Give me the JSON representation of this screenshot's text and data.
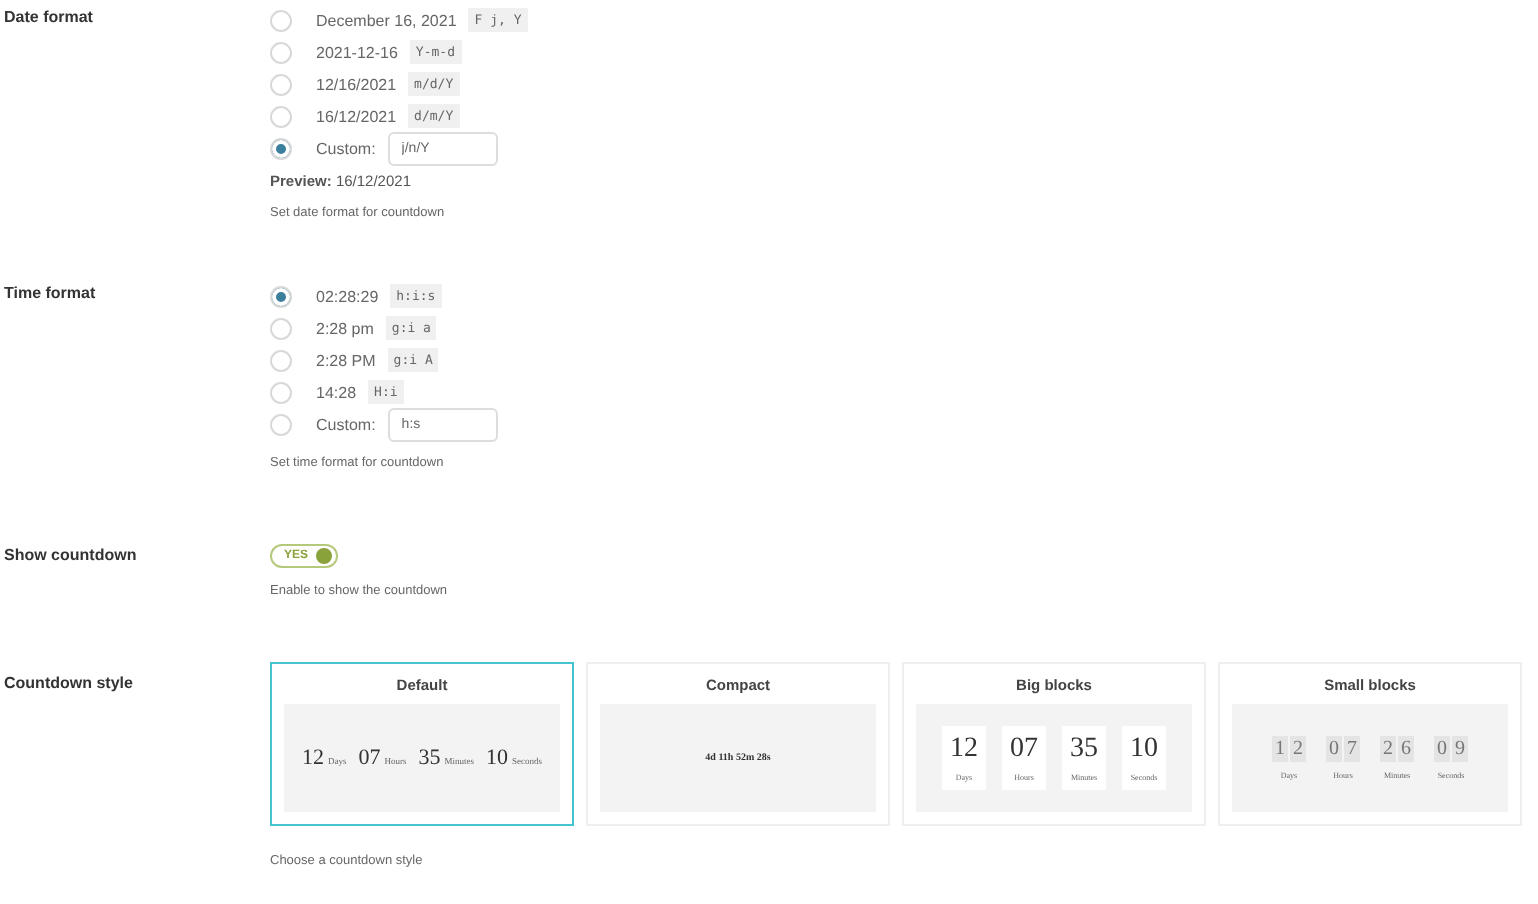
{
  "date_format": {
    "label": "Date format",
    "options": [
      {
        "kind": "preset",
        "text": "December 16, 2021",
        "code": "F j, Y",
        "selected": false
      },
      {
        "kind": "preset",
        "text": "2021-12-16",
        "code": "Y-m-d",
        "selected": false
      },
      {
        "kind": "preset",
        "text": "12/16/2021",
        "code": "m/d/Y",
        "selected": false
      },
      {
        "kind": "preset",
        "text": "16/12/2021",
        "code": "d/m/Y",
        "selected": false
      },
      {
        "kind": "custom",
        "text": "Custom:",
        "value": "j/n/Y",
        "selected": true
      }
    ],
    "preview_label": "Preview:",
    "preview_value": "16/12/2021",
    "help": "Set date format for countdown"
  },
  "time_format": {
    "label": "Time format",
    "options": [
      {
        "kind": "preset",
        "text": "02:28:29",
        "code": "h:i:s",
        "selected": true
      },
      {
        "kind": "preset",
        "text": "2:28 pm",
        "code": "g:i a",
        "selected": false
      },
      {
        "kind": "preset",
        "text": "2:28 PM",
        "code": "g:i A",
        "selected": false
      },
      {
        "kind": "preset",
        "text": "14:28",
        "code": "H:i",
        "selected": false
      },
      {
        "kind": "custom",
        "text": "Custom:",
        "value": "h:s",
        "selected": false
      }
    ],
    "help": "Set time format for countdown"
  },
  "show_countdown": {
    "label": "Show countdown",
    "toggle": {
      "on": true,
      "text": "YES"
    },
    "help": "Enable to show the countdown"
  },
  "countdown_style": {
    "label": "Countdown style",
    "help": "Choose a countdown style",
    "styles": [
      {
        "kind": "inline",
        "title": "Default",
        "selected": true,
        "units": [
          {
            "value": "12",
            "unit": "Days"
          },
          {
            "value": "07",
            "unit": "Hours"
          },
          {
            "value": "35",
            "unit": "Minutes"
          },
          {
            "value": "10",
            "unit": "Seconds"
          }
        ]
      },
      {
        "kind": "compact",
        "title": "Compact",
        "selected": false,
        "text": "4d 11h 52m 28s"
      },
      {
        "kind": "big",
        "title": "Big blocks",
        "selected": false,
        "units": [
          {
            "value": "12",
            "unit": "Days"
          },
          {
            "value": "07",
            "unit": "Hours"
          },
          {
            "value": "35",
            "unit": "Minutes"
          },
          {
            "value": "10",
            "unit": "Seconds"
          }
        ]
      },
      {
        "kind": "small",
        "title": "Small blocks",
        "selected": false,
        "units": [
          {
            "digits": [
              "1",
              "2"
            ],
            "unit": "Days"
          },
          {
            "digits": [
              "0",
              "7"
            ],
            "unit": "Hours"
          },
          {
            "digits": [
              "2",
              "6"
            ],
            "unit": "Minutes"
          },
          {
            "digits": [
              "0",
              "9"
            ],
            "unit": "Seconds"
          }
        ]
      }
    ]
  }
}
